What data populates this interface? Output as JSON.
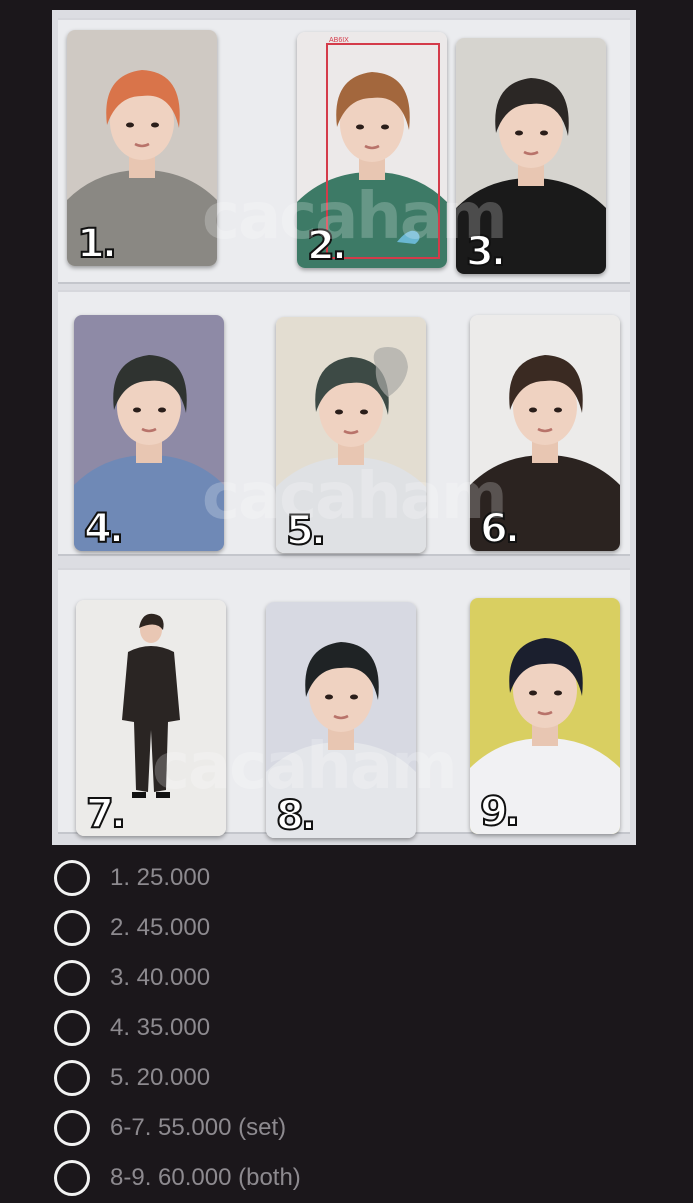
{
  "photo": {
    "description_icon": "photocard-binder-photo",
    "watermark": "cacaham",
    "cards": [
      {
        "number": "1.",
        "bg": "#cfc9c3",
        "hair": "#d9744a",
        "shirt": "#8a8883"
      },
      {
        "number": "2.",
        "bg": "#ece9e9",
        "hair": "#a3673d",
        "shirt": "#3d7a66",
        "logo": "AB6IX"
      },
      {
        "number": "3.",
        "bg": "#d6d4cf",
        "hair": "#2b2725",
        "shirt": "#1a1a1a"
      },
      {
        "number": "4.",
        "bg": "#8e8aa6",
        "hair": "#2f3330",
        "shirt": "#6f89b6"
      },
      {
        "number": "5.",
        "bg": "#e3ddd1",
        "hair": "#3d4a45",
        "shirt": "#dfe1e4"
      },
      {
        "number": "6.",
        "bg": "#ecebea",
        "hair": "#3a2a22",
        "shirt": "#2b2320"
      },
      {
        "number": "7.",
        "bg": "#ecebe9",
        "hair": "#2e2520",
        "shirt": "#2a2523"
      },
      {
        "number": "8.",
        "bg": "#d7d9e2",
        "hair": "#1f2325",
        "shirt": "#e4e6ea"
      },
      {
        "number": "9.",
        "bg": "#d9cf61",
        "hair": "#1b1f2e",
        "shirt": "#f1f1f3"
      }
    ]
  },
  "options": [
    {
      "label": "1. 25.000"
    },
    {
      "label": "2. 45.000"
    },
    {
      "label": "3. 40.000"
    },
    {
      "label": "4. 35.000"
    },
    {
      "label": "5. 20.000"
    },
    {
      "label": "6-7. 55.000 (set)"
    },
    {
      "label": "8-9. 60.000 (both)"
    }
  ],
  "colors": {
    "background": "#1b171b",
    "radio_border": "#f2f2f2",
    "option_text": "#8d8a8f"
  }
}
